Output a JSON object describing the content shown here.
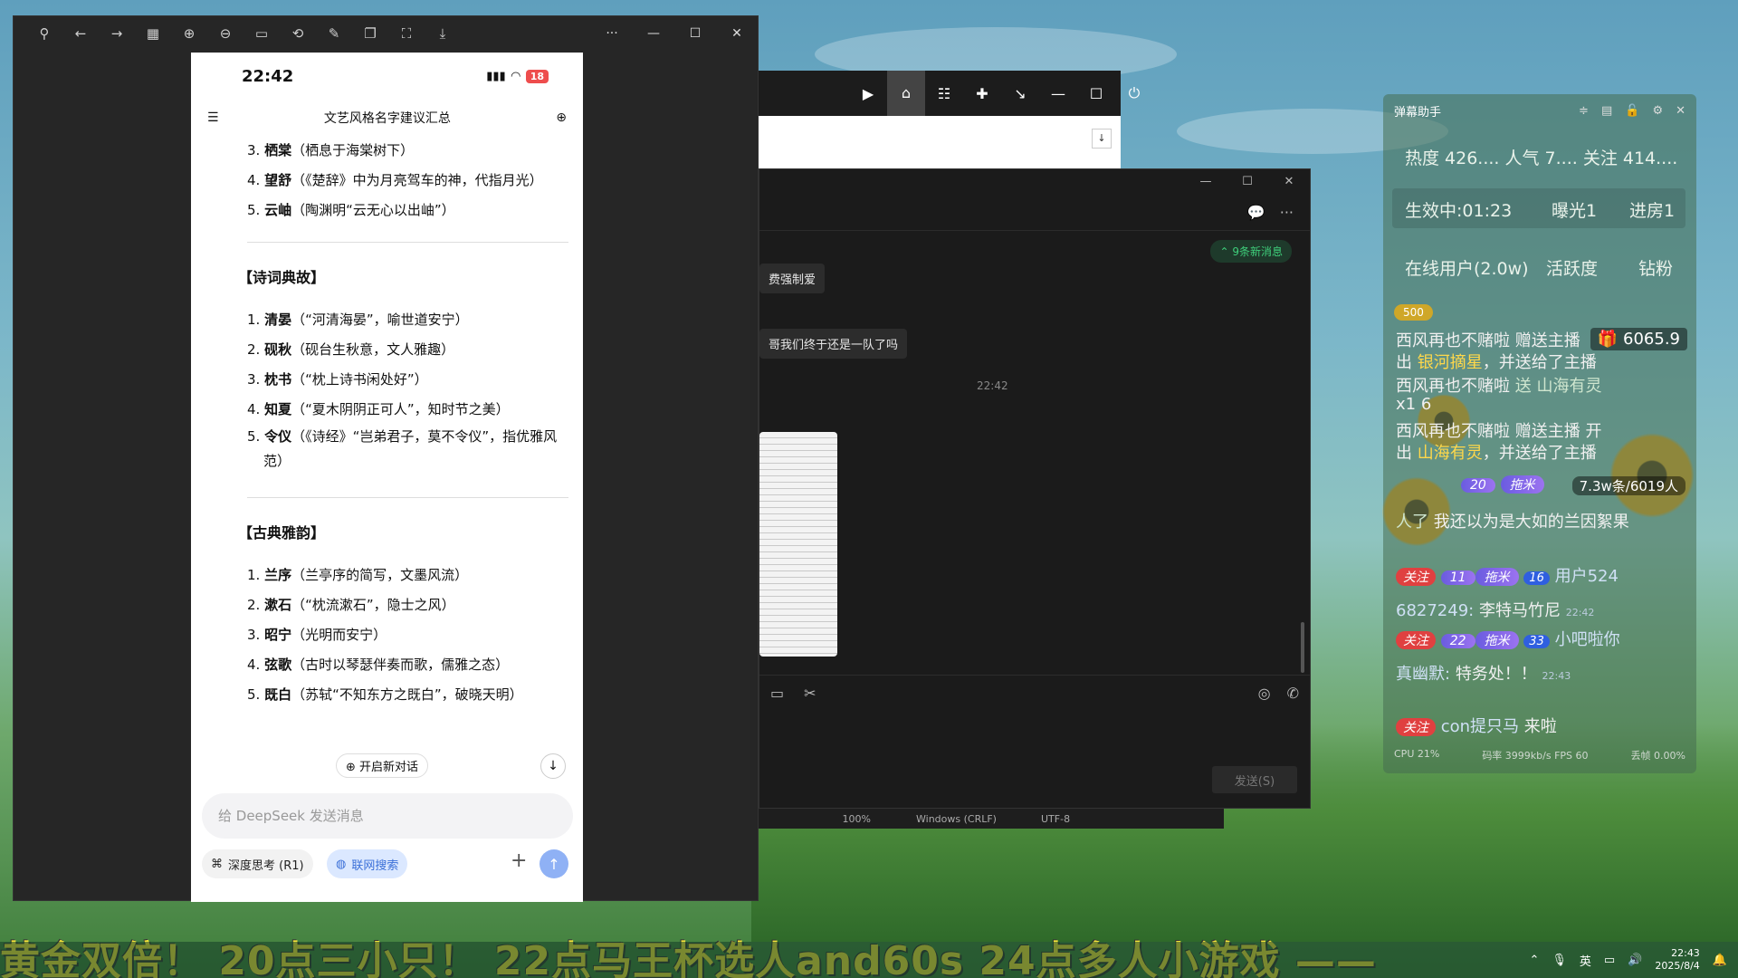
{
  "viewer": {
    "phone_time": "22:42",
    "battery": "18",
    "header_title": "文艺风格名字建议汇总",
    "top_list": [
      {
        "num": "3.",
        "name": "栖棠",
        "desc": "（栖息于海棠树下）"
      },
      {
        "num": "4.",
        "name": "望舒",
        "desc": "（《楚辞》中为月亮驾车的神，代指月光）"
      },
      {
        "num": "5.",
        "name": "云岫",
        "desc": "（陶渊明“云无心以出岫”）"
      }
    ],
    "section1_title": "【诗词典故】",
    "section1": [
      {
        "num": "1.",
        "name": "清晏",
        "desc": "（“河清海晏”，喻世道安宁）"
      },
      {
        "num": "2.",
        "name": "砚秋",
        "desc": "（砚台生秋意，文人雅趣）"
      },
      {
        "num": "3.",
        "name": "枕书",
        "desc": "（“枕上诗书闲处好”）"
      },
      {
        "num": "4.",
        "name": "知夏",
        "desc": "（“夏木阴阴正可人”，知时节之美）"
      },
      {
        "num": "5.",
        "name": "令仪",
        "desc": "（《诗经》“岂弟君子，莫不令仪”，指优雅风范）"
      }
    ],
    "section2_title": "【古典雅韵】",
    "section2": [
      {
        "num": "1.",
        "name": "兰序",
        "desc": "（兰亭序的简写，文墨风流）"
      },
      {
        "num": "2.",
        "name": "漱石",
        "desc": "（“枕流漱石”，隐士之风）"
      },
      {
        "num": "3.",
        "name": "昭宁",
        "desc": "（光明而安宁）"
      },
      {
        "num": "4.",
        "name": "弦歌",
        "desc": "（古时以琴瑟伴奏而歌，儒雅之态）"
      },
      {
        "num": "5.",
        "name": "既白",
        "desc": "（苏轼“不知东方之既白”，破晓天明）"
      }
    ],
    "new_chat_label": "开启新对话",
    "input_placeholder": "给 DeepSeek 发送消息",
    "deep_think_label": "深度思考 (R1)",
    "web_search_label": "联网搜索"
  },
  "chat": {
    "new_msg_badge": "9条新消息",
    "bubble1": "费强制爱",
    "bubble2": "哥我们终于还是一队了吗",
    "time": "22:42",
    "send_label": "发送(S)"
  },
  "notepad_status": {
    "zoom": "100%",
    "line_ending": "Windows (CRLF)",
    "encoding": "UTF-8"
  },
  "danmaku": {
    "title": "弹幕助手",
    "stats1": "热度 426....  人气 7....  关注 414....",
    "live_time": "生效中:01:23",
    "exposure": "曝光1",
    "entries": "进房1",
    "online": "在线用户(2.0w)",
    "activity": "活跃度",
    "diamond": "钻粉",
    "badge": "500",
    "gift_total": "6065.9",
    "people": "7.3w条/6019人",
    "l1a": "西风再也不赌啦 赠送主播",
    "l1b": "出 ",
    "l1c": "银河摘星",
    "l1d": "，并送给了主播",
    "l2a": "西风再也不赌啦 ",
    "l2b": "送 山海有灵",
    "l2c": "x1 ",
    "l2d": "6",
    "l3a": "西风再也不赌啦 赠送主播",
    "l3b": "开",
    "l3c": "出 ",
    "l3d": "山海有灵",
    "l3e": "，并送给了主播",
    "follow": "关注",
    "lv20": "20",
    "fans_label": "拖米",
    "row4_text": "人了",
    "row4_msg": "我还以为是大如的兰因絮果",
    "lv11": "11",
    "fan16": "16",
    "user524": "用户524",
    "user6827249": "6827249:",
    "msg_li": "李特马竹尼",
    "t2242": "22:42",
    "lv22": "22",
    "fan33": "33",
    "user_xiaoba": "小吧啦你",
    "user_zhen": "真幽默:",
    "msg_te": "特务处！！",
    "t2243": "22:43",
    "user_con": "con提只马",
    "msg_come": "来啦",
    "cpu": "CPU 21%",
    "bitrate": "码率 3999kb/s  FPS 60",
    "drop": "丢帧 0.00%"
  },
  "marquee": "黄金双倍！ 20点三小只！ 22点马王杯选人and60s 24点多人小游戏 ——",
  "taskbar": {
    "ime": "英",
    "time": "22:43",
    "date": "2025/8/4"
  }
}
